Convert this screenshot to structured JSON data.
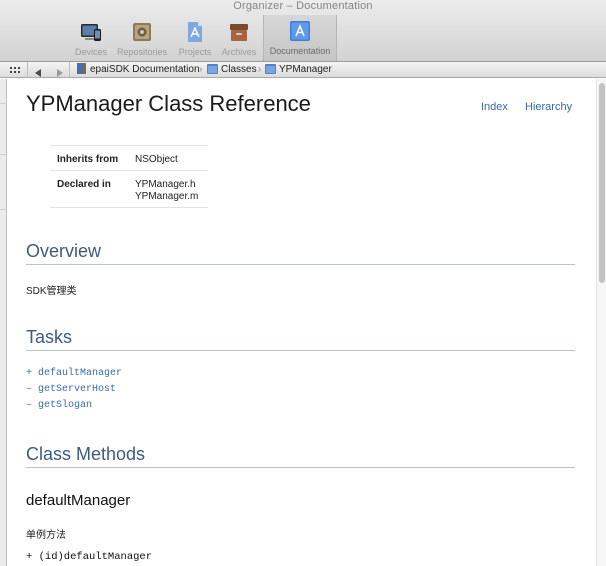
{
  "window": {
    "title": "Organizer – Documentation"
  },
  "toolbar": {
    "items": [
      {
        "label": "Devices",
        "icon": "devices-icon"
      },
      {
        "label": "Repositories",
        "icon": "repositories-icon"
      },
      {
        "label": "Projects",
        "icon": "projects-icon"
      },
      {
        "label": "Archives",
        "icon": "archives-icon"
      },
      {
        "label": "Documentation",
        "icon": "documentation-icon",
        "selected": true
      }
    ]
  },
  "jumpbar": {
    "crumbs": [
      "epaiSDK Documentation",
      "Classes",
      "YPManager"
    ]
  },
  "doc": {
    "title": "YPManager Class Reference",
    "links": {
      "index": "Index",
      "hierarchy": "Hierarchy"
    },
    "info": {
      "inherits_label": "Inherits from",
      "inherits_value": "NSObject",
      "declared_label": "Declared in",
      "declared_values": [
        "YPManager.h",
        "YPManager.m"
      ]
    },
    "overview": {
      "heading": "Overview",
      "text": "SDK管理类"
    },
    "tasks": {
      "heading": "Tasks",
      "items": [
        "+ defaultManager",
        "– getServerHost",
        "– getSlogan"
      ]
    },
    "class_methods": {
      "heading": "Class Methods",
      "method_name": "defaultManager",
      "description": "单例方法",
      "declaration": "+ (id)defaultManager"
    }
  },
  "colors": {
    "link": "#3c69a3",
    "section_heading": "#3e5a80"
  }
}
